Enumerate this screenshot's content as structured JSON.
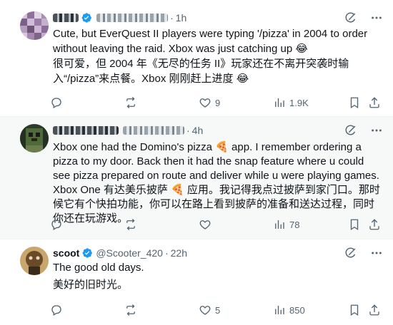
{
  "replies": [
    {
      "name": "",
      "handle": "",
      "time": "1h",
      "text_en": "Cute, but EverQuest II players were typing '/pizza' in 2004 to order without leaving the raid. Xbox was just catching up",
      "text_en_emoji": "😂",
      "text_zh": "很可爱，但 2004 年《无尽的任务 II》玩家还在不离开突袭时输入“/pizza”来点餐。Xbox 刚刚赶上进度",
      "text_zh_emoji": "😂",
      "replies_count": "",
      "reposts_count": "",
      "likes_count": "9",
      "views_count": "1.9K"
    },
    {
      "name": "",
      "handle": "",
      "time": "4h",
      "text_en_a": "Xbox one had the Domino's pizza",
      "text_en_emoji": "🍕",
      "text_en_b": "app. I remember ordering a pizza to my door. Back then it had the snap feature where u could see pizza prepared on route and deliver while u were playing games.",
      "text_zh_a": "Xbox One 有达美乐披萨",
      "text_zh_emoji": "🍕",
      "text_zh_b": "应用。我记得我点过披萨到家门口。那时候它有个快拍功能，你可以在路上看到披萨的准备和送达过程，同时你还在玩游戏。",
      "replies_count": "",
      "reposts_count": "",
      "likes_count": "",
      "views_count": "78"
    },
    {
      "name": "scoot",
      "handle": "@Scooter_420",
      "time": "22h",
      "text_en": "The good old days.",
      "text_zh": "美好的旧时光。",
      "replies_count": "",
      "reposts_count": "",
      "likes_count": "5",
      "views_count": "850"
    }
  ],
  "colors": {
    "text": "#0f1419",
    "muted": "#536471",
    "verified": "#1d9bf0",
    "divider": "#eff3f4",
    "highlight_bg": "#f7f9f9"
  },
  "icons": [
    "grok-icon",
    "more-icon",
    "reply-icon",
    "repost-icon",
    "like-icon",
    "views-icon",
    "bookmark-icon",
    "share-icon",
    "verified-badge-icon"
  ],
  "dot": "·"
}
